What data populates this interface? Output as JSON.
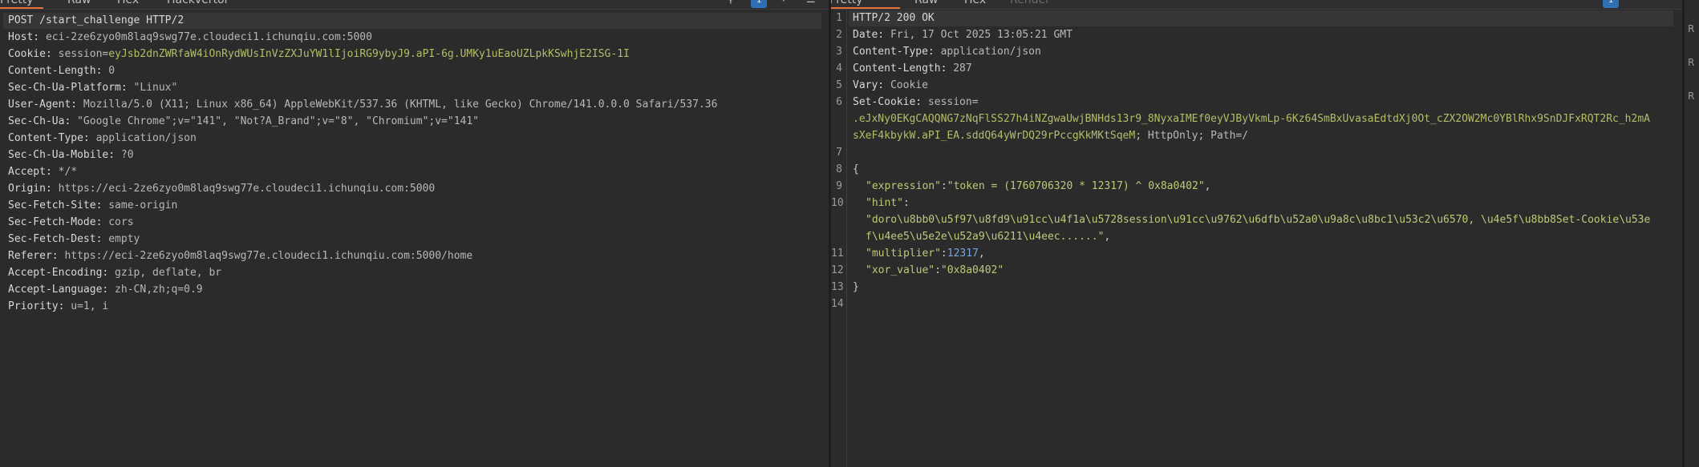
{
  "request": {
    "tabs": [
      "Pretty",
      "Raw",
      "Hex",
      "Hackvertor"
    ],
    "badge_count": "1",
    "lines": [
      {
        "key": "",
        "value": "POST /start_challenge HTTP/2"
      },
      {
        "key": "Host:",
        "value": " eci-2ze6zyo0m8laq9swg77e.cloudeci1.ichunqiu.com:5000"
      },
      {
        "key": "Cookie:",
        "cookie_name": " session",
        "cookie_eq": "=",
        "cookie_value": "eyJsb2dnZWRfaW4iOnRydWUsInVzZXJuYW1lIjoiRG9ybyJ9.aPI-6g.UMKy1uEaoUZLpkKSwhjE2ISG-1I"
      },
      {
        "key": "Content-Length:",
        "value": " 0"
      },
      {
        "key": "Sec-Ch-Ua-Platform:",
        "value": " \"Linux\""
      },
      {
        "key": "User-Agent:",
        "value": " Mozilla/5.0 (X11; Linux x86_64) AppleWebKit/537.36 (KHTML, like Gecko) Chrome/141.0.0.0 Safari/537.36"
      },
      {
        "key": "Sec-Ch-Ua:",
        "value": " \"Google Chrome\";v=\"141\", \"Not?A_Brand\";v=\"8\", \"Chromium\";v=\"141\""
      },
      {
        "key": "Content-Type:",
        "value": " application/json"
      },
      {
        "key": "Sec-Ch-Ua-Mobile:",
        "value": " ?0"
      },
      {
        "key": "Accept:",
        "value": " */*"
      },
      {
        "key": "Origin:",
        "value": " https://eci-2ze6zyo0m8laq9swg77e.cloudeci1.ichunqiu.com:5000"
      },
      {
        "key": "Sec-Fetch-Site:",
        "value": " same-origin"
      },
      {
        "key": "Sec-Fetch-Mode:",
        "value": " cors"
      },
      {
        "key": "Sec-Fetch-Dest:",
        "value": " empty"
      },
      {
        "key": "Referer:",
        "value": " https://eci-2ze6zyo0m8laq9swg77e.cloudeci1.ichunqiu.com:5000/home"
      },
      {
        "key": "Accept-Encoding:",
        "value": " gzip, deflate, br"
      },
      {
        "key": "Accept-Language:",
        "value": " zh-CN,zh;q=0.9"
      },
      {
        "key": "Priority:",
        "value": " u=1, i"
      }
    ]
  },
  "response": {
    "tabs": [
      "Pretty",
      "Raw",
      "Hex",
      "Render"
    ],
    "badge_count": "1",
    "line_numbers": [
      "1",
      "2",
      "3",
      "4",
      "5",
      "6",
      "7",
      "8",
      "9",
      "10",
      "11",
      "12",
      "13",
      "14"
    ],
    "status_line": "HTTP/2 200 OK",
    "headers": [
      {
        "key": "Date:",
        "value": " Fri, 17 Oct 2025 13:05:21 GMT"
      },
      {
        "key": "Content-Type:",
        "value": " application/json"
      },
      {
        "key": "Content-Length:",
        "value": " 287"
      },
      {
        "key": "Vary:",
        "value": " Cookie"
      }
    ],
    "set_cookie": {
      "key": "Set-Cookie:",
      "name": " session",
      "eq": "=",
      "value_line1": ".eJxNy0EKgCAQQNG7zNqFlSS27h4iNZgwaUwjBNHds13r9_8NyxaIMEf0eyVJByVkmLp-6Kz64SmBxUvasaEdtdXj0Ot_cZX2OW2Mc0YBlRhx9SnDJFxRQT2Rc_h2mA",
      "value_line2": "sXeF4kbykW.aPI_EA.sddQ64yWrDQ29rPccgKkMKtSqeM",
      "attrs": "; HttpOnly; Path=/"
    },
    "json": {
      "open": "{",
      "close": "}",
      "expression_key": "\"expression\"",
      "expression_value": "\"token = (1760706320 * 12317) ^ 0x8a0402\"",
      "hint_key": "\"hint\"",
      "hint_value_line1": "\"doro\\u8bb0\\u5f97\\u8fd9\\u91cc\\u4f1a\\u5728session\\u91cc\\u9762\\u6dfb\\u52a0\\u9a8c\\u8bc1\\u53c2\\u6570, \\u4e5f\\u8bb8Set-Cookie\\u53e",
      "hint_value_line2": "f\\u4ee5\\u5e2e\\u52a9\\u6211\\u4eec......\"",
      "multiplier_key": "\"multiplier\"",
      "multiplier_value": "12317",
      "xor_key": "\"xor_value\"",
      "xor_value": "\"0x8a0402\""
    }
  },
  "side_buttons": [
    "R",
    "R",
    "R"
  ]
}
